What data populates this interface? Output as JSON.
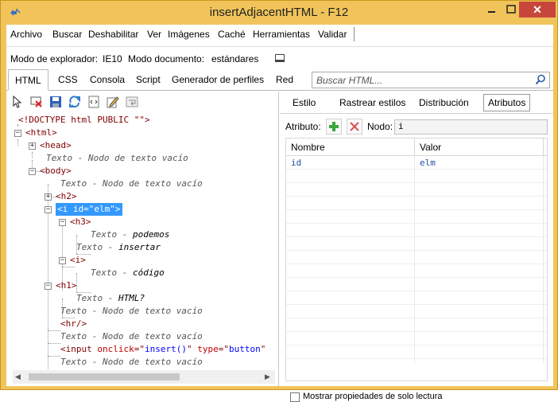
{
  "window": {
    "title": "insertAdjacentHTML - F12",
    "close_glyph": "✕"
  },
  "menu": [
    "Archivo",
    "Buscar",
    "Deshabilitar",
    "Ver",
    "Imágenes",
    "Caché",
    "Herramientas",
    "Validar"
  ],
  "mode": {
    "browser_label": "Modo de explorador:",
    "browser_value": "IE10",
    "document_label": "Modo documento:",
    "document_value": "estándares"
  },
  "tabs": [
    "HTML",
    "CSS",
    "Consola",
    "Script",
    "Generador de perfiles",
    "Red"
  ],
  "active_tab": "HTML",
  "search": {
    "placeholder": "Buscar HTML..."
  },
  "toolbar_icons": [
    "select-element-icon",
    "clear-highlight-icon",
    "save-icon",
    "refresh-icon",
    "source-icon",
    "edit-icon",
    "word-wrap-icon"
  ],
  "tree": {
    "doctype": "<!DOCTYPE html PUBLIC \"\">",
    "html": "<html>",
    "head": "<head>",
    "empty_text": "Texto - Nodo de texto vacío",
    "body": "<body>",
    "h2": "<h2>",
    "selected_open": "<i ",
    "selected_attr": "id",
    "selected_eq": "=\"",
    "selected_val": "elm",
    "selected_close": "\">",
    "h3": "<h3>",
    "text_label": "Texto - ",
    "text_podemos": "podemos",
    "text_insertar": "insertar",
    "i_tag": "<i>",
    "text_codigo": " código",
    "h1": "<h1>",
    "text_html": " HTML?",
    "hr": "<hr/>",
    "input_open": "<input ",
    "input_attr1": "onclick",
    "input_val1": "insert()",
    "input_attr2": "type",
    "input_val2": "button"
  },
  "right": {
    "subtabs": [
      "Estilo",
      "Rastrear estilos",
      "Distribución",
      "Atributos"
    ],
    "active_subtab": "Atributos",
    "attr_label": "Atributo:",
    "node_label": "Nodo:",
    "node_value": "i",
    "columns": [
      "Nombre",
      "Valor"
    ],
    "rows": [
      {
        "name": "id",
        "value": "elm"
      }
    ],
    "readonly_label": "Mostrar propiedades de solo lectura"
  },
  "colors": {
    "titlebar": "#f0c45a",
    "selection": "#3399ff",
    "close": "#c7463c"
  }
}
